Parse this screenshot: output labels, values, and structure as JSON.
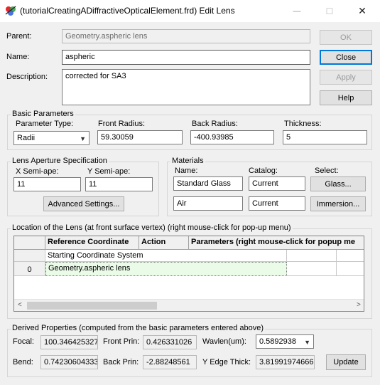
{
  "window": {
    "title": "(tutorialCreatingADiffractiveOpticalElement.frd) Edit Lens",
    "min_glyph": "—",
    "max_glyph": "☐",
    "close_glyph": "✕"
  },
  "top": {
    "parent_label": "Parent:",
    "parent_value": "Geometry.aspheric lens",
    "name_label": "Name:",
    "name_value": "aspheric",
    "description_label": "Description:",
    "description_value": "corrected for SA3"
  },
  "buttons": {
    "ok": "OK",
    "close": "Close",
    "apply": "Apply",
    "help": "Help",
    "advanced": "Advanced Settings...",
    "glass": "Glass...",
    "immersion": "Immersion...",
    "update": "Update"
  },
  "basic": {
    "title": "Basic Parameters",
    "param_type_label": "Parameter Type:",
    "param_type_value": "Radii",
    "front_radius_label": "Front Radius:",
    "front_radius_value": "59.30059",
    "back_radius_label": "Back Radius:",
    "back_radius_value": "-400.93985",
    "thickness_label": "Thickness:",
    "thickness_value": "5"
  },
  "aperture": {
    "title": "Lens Aperture Specification",
    "x_label": "X Semi-ape:",
    "x_value": "11",
    "y_label": "Y Semi-ape:",
    "y_value": "11"
  },
  "materials": {
    "title": "Materials",
    "name_label": "Name:",
    "catalog_label": "Catalog:",
    "select_label": "Select:",
    "row1_name": "Standard Glass",
    "row1_catalog": "Current",
    "row2_name": "Air",
    "row2_catalog": "Current"
  },
  "location": {
    "title": "Location of the Lens (at front surface vertex)   (right mouse-click for pop-up menu)",
    "headers": {
      "ref": "Reference Coordinate",
      "action": "Action",
      "params": "Parameters (right mouse-click for popup me"
    },
    "row0_ref": "Starting Coordinate System",
    "row1_index": "0",
    "row1_ref": "Geometry.aspheric lens",
    "scroll_left": "<",
    "scroll_right": ">"
  },
  "derived": {
    "title": "Derived Properties (computed from the basic parameters entered above)",
    "focal_label": "Focal:",
    "focal_value": "100.346425327",
    "front_prin_label": "Front Prin:",
    "front_prin_value": "0.426331026",
    "wavlen_label": "Wavlen(um):",
    "wavlen_value": "0.5892938",
    "bend_label": "Bend:",
    "bend_value": "0.74230604333",
    "back_prin_label": "Back Prin:",
    "back_prin_value": "-2.88248561",
    "y_edge_label": "Y Edge Thick:",
    "y_edge_value": "3.81991974666"
  }
}
